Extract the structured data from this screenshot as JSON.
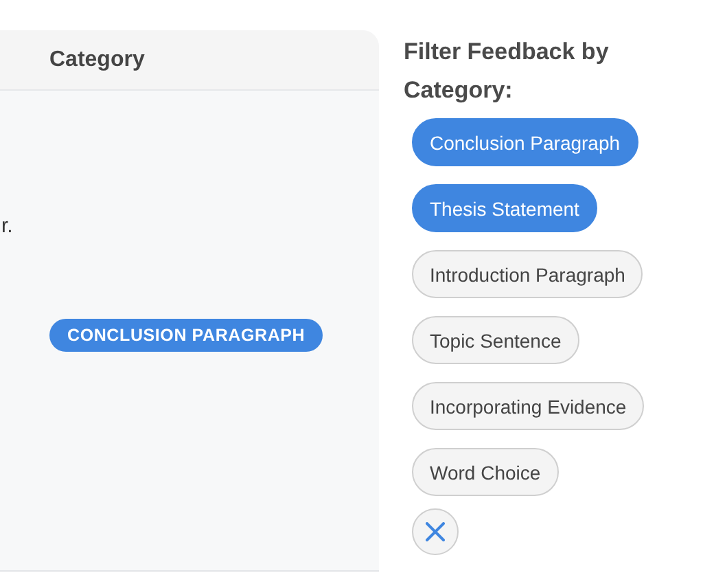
{
  "table": {
    "columns": [
      "Category"
    ],
    "rows": [
      {
        "text": "r.",
        "category": "CONCLUSION PARAGRAPH"
      }
    ]
  },
  "filter": {
    "title": "Filter Feedback by Category:",
    "chips": [
      {
        "label": "Conclusion Paragraph",
        "selected": true
      },
      {
        "label": "Thesis Statement",
        "selected": true
      },
      {
        "label": "Introduction Paragraph",
        "selected": false
      },
      {
        "label": "Topic Sentence",
        "selected": false
      },
      {
        "label": "Incorporating Evidence",
        "selected": false
      },
      {
        "label": "Word Choice",
        "selected": false
      }
    ]
  }
}
